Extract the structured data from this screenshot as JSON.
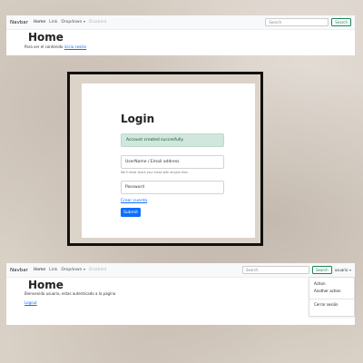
{
  "panel_top": {
    "navbar": {
      "brand": "Navbar",
      "links": [
        "Home",
        "Link",
        "Dropdown",
        "Disabled"
      ],
      "search_placeholder": "Search",
      "search_button": "Search"
    },
    "heading": "Home",
    "message": "Para ver el contenido ",
    "login_link": "inicia sesión"
  },
  "login": {
    "title": "Login",
    "alert": "Account created succesfully",
    "email_placeholder": "UserName / Email address",
    "email_help": "We'll never share your email with anyone else.",
    "password_placeholder": "Password",
    "create_account_link": "Crear cuenta",
    "submit_label": "Submit"
  },
  "panel_bottom": {
    "navbar": {
      "brand": "Navbar",
      "links": [
        "Home",
        "Link",
        "Dropdown",
        "Disabled"
      ],
      "search_placeholder": "Search",
      "search_button": "Search",
      "user_menu": "usuario"
    },
    "dropdown_items": [
      "Action",
      "Another action",
      "Cerrar sesión"
    ],
    "heading": "Home",
    "message": "Bienvenido usuario, estas autenticado a la pagina",
    "logout_link": "Logout"
  },
  "colors": {
    "primary": "#0d6efd",
    "success": "#198754",
    "alert_bg": "#d1e7dd",
    "alert_text": "#0f5132"
  }
}
